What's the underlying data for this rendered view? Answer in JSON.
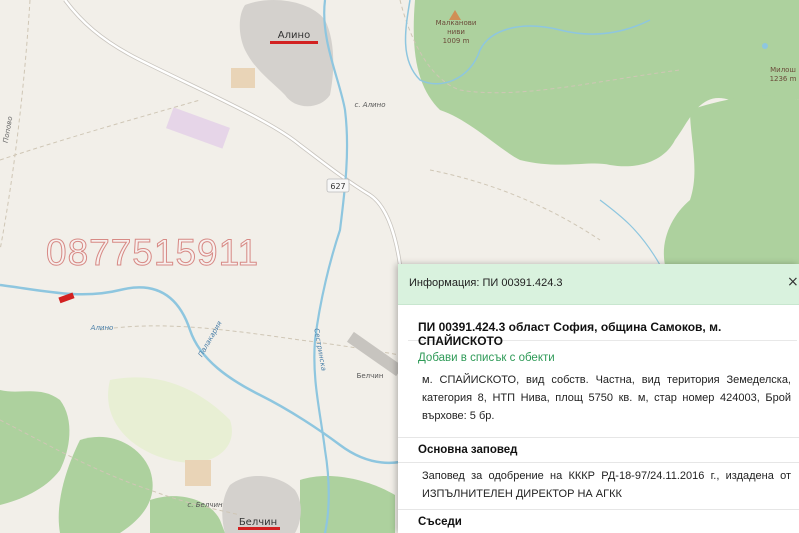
{
  "map": {
    "towns": [
      {
        "name": "Алино"
      },
      {
        "name": "Белчин"
      }
    ],
    "labels": {
      "peak1_name": "Малканови",
      "peak1_name2": "ниви",
      "peak1_elev": "1009 m",
      "peak2_name": "Милош",
      "peak2_elev": "1236 m",
      "road_number": "627",
      "road_s_alino": "с. Алино",
      "road_s_belchin": "с. Белчин",
      "river_alino": "Алино",
      "river_palakariya": "Палакария",
      "river_sestrinska": "Сестринска",
      "belchin_label": "Белчин",
      "left_road": "Попово"
    },
    "colors": {
      "background": "#f2efe9",
      "forest": "#add19e",
      "river": "#aad3df",
      "river_stroke": "#8ec6df",
      "urban": "#d4d1cd",
      "red_marker": "#d22121"
    }
  },
  "watermark": {
    "text": "0877515911"
  },
  "panel": {
    "title": "Информация: ПИ 00391.424.3",
    "close_label": "×",
    "parcel_title": "ПИ 00391.424.3 област София, община Самоков, м. СПАЙИСКОТО",
    "add_link": "Добави в списък с обекти",
    "description": "м. СПАЙИСКОТО, вид собств. Частна, вид територия Земеделска, категория 8, НТП Нива, площ 5750 кв. м, стар номер 424003, Брой върхове: 5 бр.",
    "section1_title": "Основна заповед",
    "section1_text": "Заповед за одобрение на КККР РД-18-97/24.11.2016 г., издадена от ИЗПЪЛНИТЕЛЕН ДИРЕКТОР НА АГКК",
    "section2_title": "Съседи"
  }
}
